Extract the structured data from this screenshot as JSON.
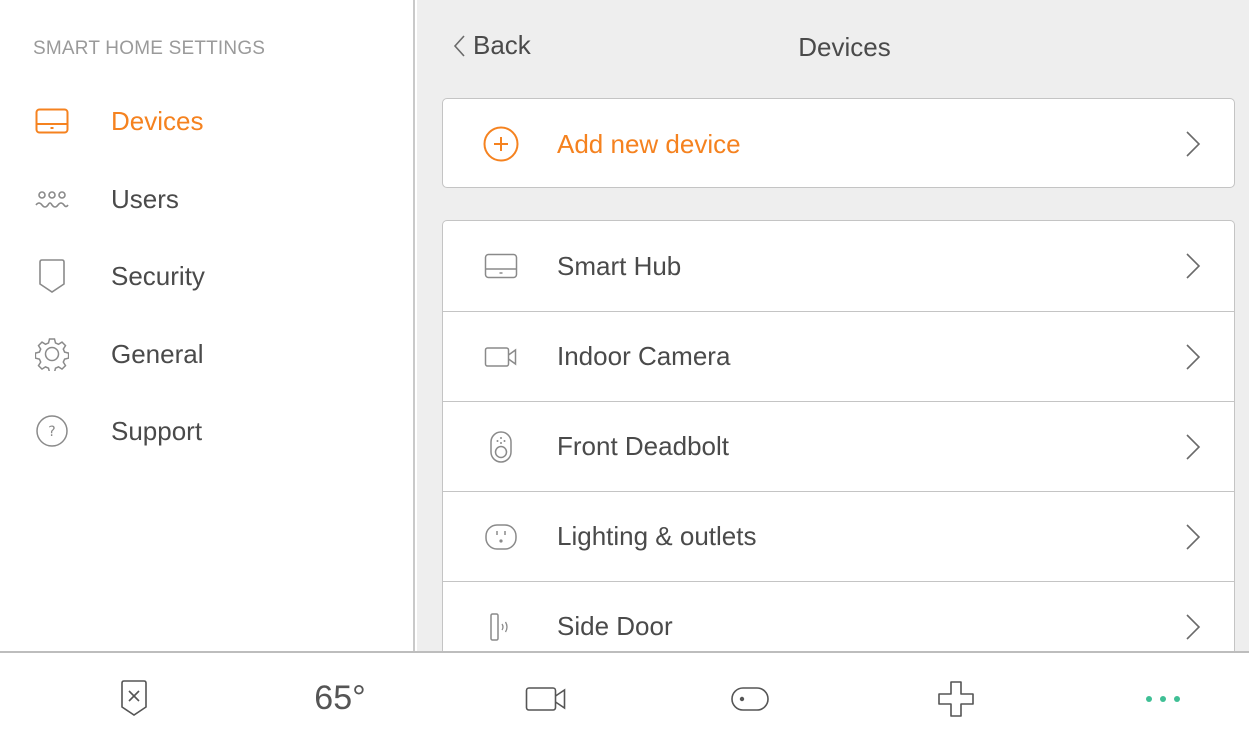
{
  "sidebar": {
    "heading": "SMART HOME SETTINGS",
    "items": [
      {
        "label": "Devices",
        "icon": "hub-icon",
        "active": true
      },
      {
        "label": "Users",
        "icon": "users-icon",
        "active": false
      },
      {
        "label": "Security",
        "icon": "shield-icon",
        "active": false
      },
      {
        "label": "General",
        "icon": "gear-icon",
        "active": false
      },
      {
        "label": "Support",
        "icon": "help-icon",
        "active": false
      }
    ]
  },
  "header": {
    "back_label": "Back",
    "title": "Devices"
  },
  "add_device": {
    "label": "Add new device",
    "icon": "plus-circle-icon"
  },
  "devices": [
    {
      "label": "Smart Hub",
      "icon": "hub-icon"
    },
    {
      "label": "Indoor Camera",
      "icon": "camera-icon"
    },
    {
      "label": "Front Deadbolt",
      "icon": "deadbolt-icon"
    },
    {
      "label": "Lighting & outlets",
      "icon": "outlet-icon"
    },
    {
      "label": "Side Door",
      "icon": "door-sensor-icon"
    }
  ],
  "bottom_bar": {
    "items": [
      {
        "name": "security-status",
        "icon": "shield-x-icon"
      },
      {
        "name": "thermostat",
        "text": "65°"
      },
      {
        "name": "camera",
        "icon": "camera-icon"
      },
      {
        "name": "lock",
        "icon": "toggle-icon"
      },
      {
        "name": "add",
        "icon": "plus-icon"
      },
      {
        "name": "more",
        "icon": "more-dots-icon"
      }
    ]
  },
  "colors": {
    "accent": "#f5821f",
    "more_dots": "#3fbf95",
    "text": "#4a4a4a",
    "muted": "#9a9a9a",
    "main_bg": "#eeeeee"
  }
}
